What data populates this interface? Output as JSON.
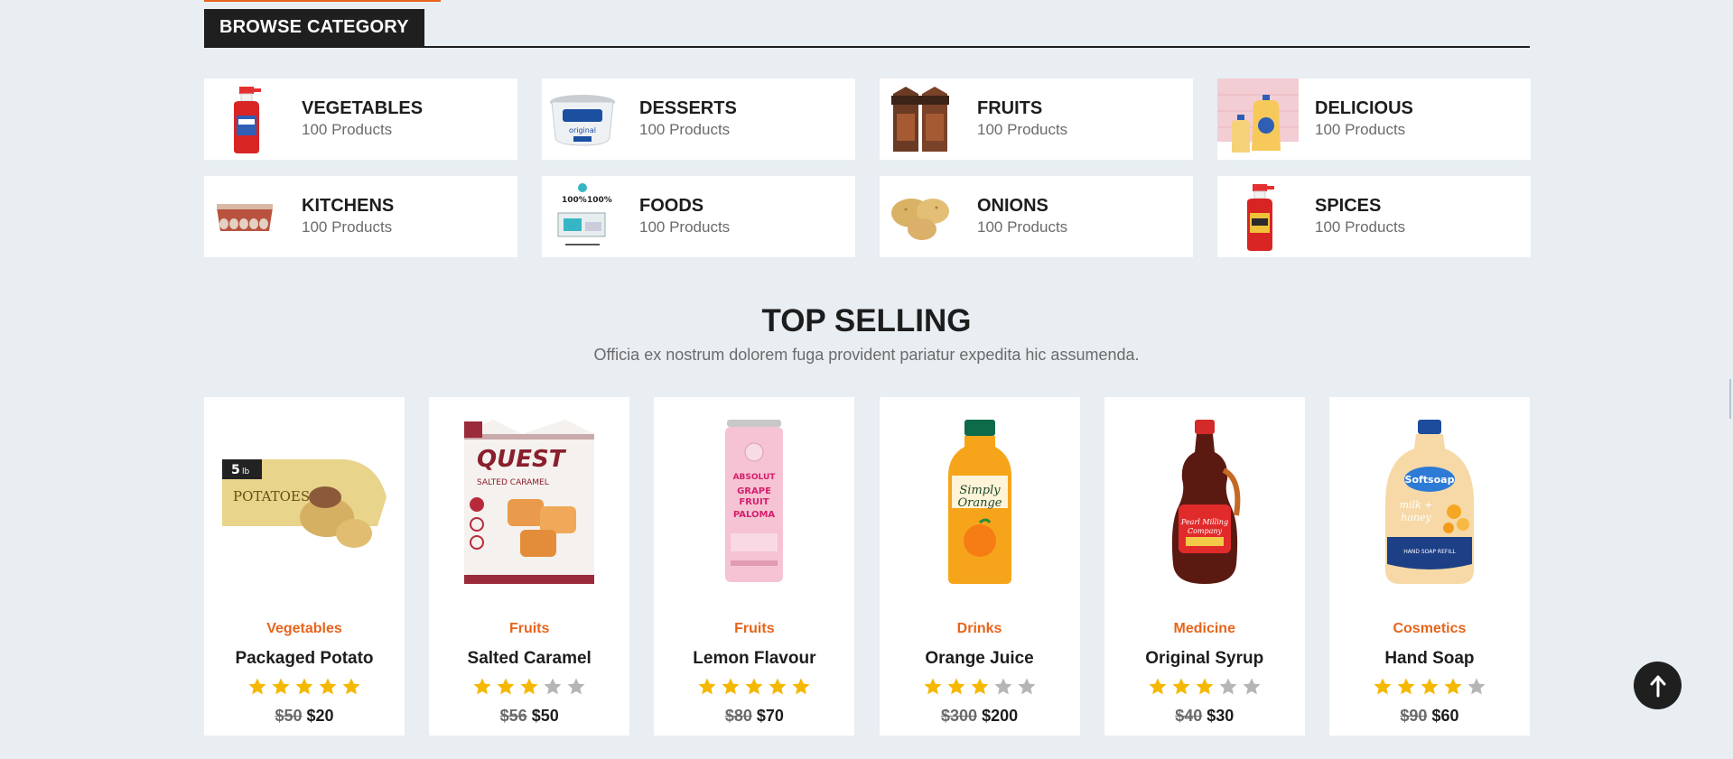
{
  "browse": {
    "title": "BROWSE CATEGORY",
    "categories": [
      {
        "name": "VEGETABLES",
        "count": "100 Products",
        "icon": "spray-bottle-icon"
      },
      {
        "name": "DESSERTS",
        "count": "100 Products",
        "icon": "cream-cheese-tub-icon"
      },
      {
        "name": "FRUITS",
        "count": "100 Products",
        "icon": "drink-carton-pack-icon"
      },
      {
        "name": "DELICIOUS",
        "count": "100 Products",
        "icon": "soap-bottles-icon"
      },
      {
        "name": "KITCHENS",
        "count": "100 Products",
        "icon": "egg-tray-icon"
      },
      {
        "name": "FOODS",
        "count": "100 Products",
        "icon": "supplement-box-icon"
      },
      {
        "name": "ONIONS",
        "count": "100 Products",
        "icon": "potatoes-icon"
      },
      {
        "name": "SPICES",
        "count": "100 Products",
        "icon": "spray-bottle-icon"
      }
    ]
  },
  "top_selling": {
    "title": "TOP SELLING",
    "subtitle": "Officia ex nostrum dolorem fuga provident pariatur expedita hic assumenda.",
    "products": [
      {
        "category": "Vegetables",
        "name": "Packaged Potato",
        "rating": 5,
        "old_price": "$50",
        "price": "$20",
        "icon": "potato-bag-icon"
      },
      {
        "category": "Fruits",
        "name": "Salted Caramel",
        "rating": 3,
        "old_price": "$56",
        "price": "$50",
        "icon": "protein-shake-pack-icon"
      },
      {
        "category": "Fruits",
        "name": "Lemon Flavour",
        "rating": 5,
        "old_price": "$80",
        "price": "$70",
        "icon": "drink-can-icon"
      },
      {
        "category": "Drinks",
        "name": "Orange Juice",
        "rating": 3,
        "old_price": "$300",
        "price": "$200",
        "icon": "juice-bottle-icon"
      },
      {
        "category": "Medicine",
        "name": "Original Syrup",
        "rating": 3,
        "old_price": "$40",
        "price": "$30",
        "icon": "syrup-bottle-icon"
      },
      {
        "category": "Cosmetics",
        "name": "Hand Soap",
        "rating": 4,
        "old_price": "$90",
        "price": "$60",
        "icon": "soap-refill-bottle-icon"
      }
    ]
  },
  "colors": {
    "accent": "#e8641a",
    "star_filled": "#f5b800",
    "star_empty": "#b5b5b5",
    "page_bg": "#e8eef2"
  },
  "back_to_top": {
    "icon": "arrow-up-icon"
  }
}
